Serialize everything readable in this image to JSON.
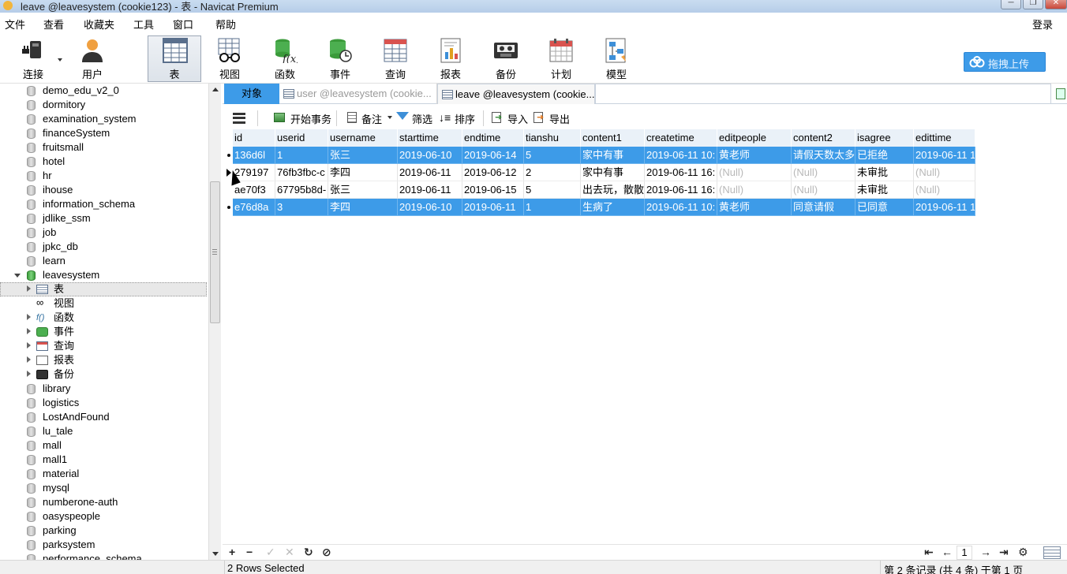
{
  "window": {
    "title": "leave @leavesystem (cookie123) - 表 - Navicat Premium",
    "controls": [
      "minimize",
      "restore",
      "close"
    ]
  },
  "menu": {
    "items": [
      "文件",
      "查看",
      "收藏夹",
      "工具",
      "窗口",
      "帮助"
    ],
    "login": "登录"
  },
  "toolbar": {
    "items": [
      {
        "label": "连接",
        "icon": "plug-icon"
      },
      {
        "label": "用户",
        "icon": "user-icon"
      },
      {
        "label": "表",
        "icon": "table-icon",
        "active": true
      },
      {
        "label": "视图",
        "icon": "view-glasses-icon"
      },
      {
        "label": "函数",
        "icon": "function-icon"
      },
      {
        "label": "事件",
        "icon": "event-clock-icon"
      },
      {
        "label": "查询",
        "icon": "query-icon"
      },
      {
        "label": "报表",
        "icon": "report-icon"
      },
      {
        "label": "备份",
        "icon": "backup-tape-icon"
      },
      {
        "label": "计划",
        "icon": "calendar-icon"
      },
      {
        "label": "模型",
        "icon": "model-icon"
      }
    ],
    "upload_label": "拖拽上传"
  },
  "sidebar": {
    "databases": [
      "demo_edu_v2_0",
      "dormitory",
      "examination_system",
      "financeSystem",
      "fruitsmall",
      "hotel",
      "hr",
      "ihouse",
      "information_schema",
      "jdlike_ssm",
      "job",
      "jpkc_db",
      "learn"
    ],
    "open_db": "leavesystem",
    "children": [
      {
        "label": "表",
        "icon": "table-icon"
      },
      {
        "label": "视图",
        "icon": "view-glasses-icon"
      },
      {
        "label": "函数",
        "icon": "function-icon"
      },
      {
        "label": "事件",
        "icon": "event-clock-icon"
      },
      {
        "label": "查询",
        "icon": "query-icon"
      },
      {
        "label": "报表",
        "icon": "report-icon"
      },
      {
        "label": "备份",
        "icon": "backup-tape-icon"
      }
    ],
    "databases_after": [
      "library",
      "logistics",
      "LostAndFound",
      "lu_tale",
      "mall",
      "mall1",
      "material",
      "mysql",
      "numberone-auth",
      "oasyspeople",
      "parking",
      "parksystem",
      "performance_schema"
    ]
  },
  "tabs": {
    "objects": "对象",
    "user_tab": "user @leavesystem (cookie...",
    "leave_tab": "leave @leavesystem (cookie..."
  },
  "grid_toolbar": {
    "begin_transaction": "开始事务",
    "memo": "备注",
    "filter": "筛选",
    "sort": "排序",
    "import": "导入",
    "export": "导出"
  },
  "grid": {
    "columns": [
      "id",
      "userid",
      "username",
      "starttime",
      "endtime",
      "tianshu",
      "content1",
      "createtime",
      "editpeople",
      "content2",
      "isagree",
      "edittime"
    ],
    "rows": [
      {
        "selected": true,
        "marker": "dot",
        "cells": [
          "136d6l",
          "1",
          "张三",
          "2019-06-10",
          "2019-06-14",
          "5",
          "家中有事",
          "2019-06-11 10:",
          "黄老师",
          "请假天数太多",
          "已拒绝",
          "2019-06-11 1"
        ]
      },
      {
        "selected": false,
        "marker": "arrow",
        "cells": [
          "279197",
          "76fb3fbc-c",
          "李四",
          "2019-06-11",
          "2019-06-12",
          "2",
          "家中有事",
          "2019-06-11 16:",
          "(Null)",
          "(Null)",
          "未审批",
          "(Null)"
        ]
      },
      {
        "selected": false,
        "marker": "",
        "cells": [
          "ae70f3",
          "67795b8d-",
          "张三",
          "2019-06-11",
          "2019-06-15",
          "5",
          "出去玩，散散心",
          "2019-06-11 16:",
          "(Null)",
          "(Null)",
          "未审批",
          "(Null)"
        ]
      },
      {
        "selected": true,
        "marker": "dot",
        "cells": [
          "e76d8a",
          "3",
          "李四",
          "2019-06-10",
          "2019-06-11",
          "1",
          "生病了",
          "2019-06-11 10:",
          "黄老师",
          "同意请假",
          "已同意",
          "2019-06-11 1"
        ]
      }
    ]
  },
  "pager": {
    "page": "1"
  },
  "status": {
    "left": "2 Rows Selected",
    "right": "第 2 条记录 (共 4 条) 于第 1 页"
  }
}
